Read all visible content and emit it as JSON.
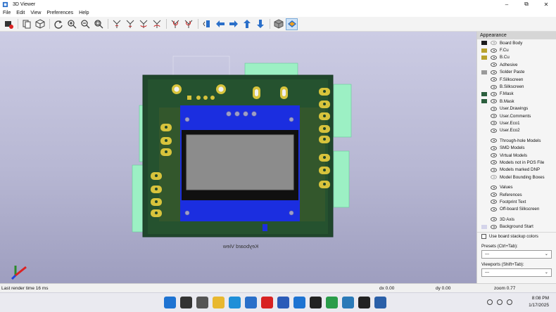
{
  "window": {
    "title": "3D Viewer"
  },
  "menu": [
    "File",
    "Edit",
    "View",
    "Preferences",
    "Help"
  ],
  "toolbar_icons": [
    "render-icon",
    "copy-icon",
    "view-3d-icon",
    "refresh-icon",
    "zoom-in-icon",
    "zoom-out-icon",
    "zoom-fit-icon",
    "rotate-x-cw-icon",
    "rotate-x-ccw-icon",
    "rotate-y-cw-icon",
    "rotate-y-ccw-icon",
    "rotate-z-cw-icon",
    "rotate-z-ccw-icon",
    "flip-board-icon",
    "pan-left-icon",
    "pan-right-icon",
    "pan-up-icon",
    "pan-down-icon",
    "ortho-icon",
    "layers-icon"
  ],
  "viewport": {
    "board_text": "Keyboard View"
  },
  "appearance": {
    "title": "Appearance",
    "layers": [
      {
        "name": "Board Body",
        "swatch": "#1c1c1c",
        "icon": "no-vis"
      },
      {
        "name": "F.Cu",
        "swatch": "#b8a22e"
      },
      {
        "name": "B.Cu",
        "swatch": "#b8a22e"
      },
      {
        "name": "Adhesive",
        "swatch": ""
      },
      {
        "name": "Solder Paste",
        "swatch": "#9a9a9a"
      },
      {
        "name": "F.Silkscreen",
        "swatch": ""
      },
      {
        "name": "B.Silkscreen",
        "swatch": ""
      },
      {
        "name": "F.Mask",
        "swatch": "#2b5f3e"
      },
      {
        "name": "B.Mask",
        "swatch": "#2b5f3e"
      },
      {
        "name": "User.Drawings",
        "swatch": ""
      },
      {
        "name": "User.Comments",
        "swatch": ""
      },
      {
        "name": "User.Eco1",
        "swatch": ""
      },
      {
        "name": "User.Eco2",
        "swatch": ""
      }
    ],
    "models": [
      {
        "name": "Through-hole Models"
      },
      {
        "name": "SMD Models"
      },
      {
        "name": "Virtual Models"
      },
      {
        "name": "Models not in POS File"
      },
      {
        "name": "Models marked DNP"
      },
      {
        "name": "Model Bounding Boxes",
        "icon": "no-vis"
      }
    ],
    "text": [
      {
        "name": "Values"
      },
      {
        "name": "References"
      },
      {
        "name": "Footprint Text"
      },
      {
        "name": "Off-board Silkscreen"
      }
    ],
    "misc": [
      {
        "name": "3D Axis"
      },
      {
        "name": "Background Start",
        "swatch": "#d4d4ea"
      }
    ],
    "use_stackup": "Use board stackup colors",
    "presets_label": "Presets (Ctrl+Tab):",
    "presets_value": "---",
    "viewports_label": "Viewports (Shift+Tab):",
    "viewports_value": "---"
  },
  "status": {
    "render_time": "Last render time 16 ms",
    "dx": "dx 0.00",
    "dy": "dy 0.00",
    "zoom": "zoom 0.77"
  },
  "taskbar": {
    "apps": [
      "start-icon",
      "search-icon",
      "task-view-icon",
      "file-explorer-icon",
      "edge-icon",
      "store-icon",
      "opera-icon",
      "word-icon",
      "files-icon",
      "github-icon",
      "chrome-icon",
      "chrome-alt-icon",
      "inkscape-icon",
      "kicad-icon"
    ],
    "time": "8:08 PM",
    "date": "1/17/2025"
  },
  "colors": {
    "board": "#20472c",
    "pad": "#d7c33c",
    "blue_mask": "#1b2ee0",
    "screen": "#8c8c8c",
    "keycap": "#9cf0c4"
  }
}
